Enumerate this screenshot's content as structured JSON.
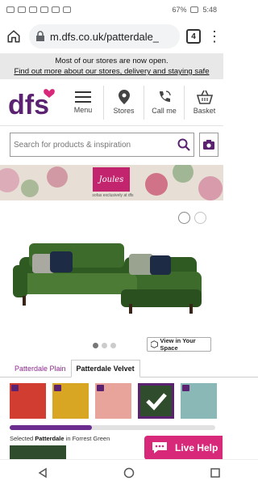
{
  "status_bar": {
    "left_icons": [
      "nfc-icon",
      "signal-icon",
      "wifi-icon",
      "battery-saver-icon",
      "alarm-icon",
      "bluetooth-icon",
      "vibrate-icon",
      "no-sound-icon"
    ],
    "battery": "67%",
    "time": "5:48"
  },
  "browser": {
    "url": "m.dfs.co.uk/patterdale_",
    "tab_count": "4"
  },
  "notice": {
    "line1": "Most of our stores are now open.",
    "link": "Find out more about our stores, delivery and staying safe"
  },
  "header": {
    "logo_text": "dfs",
    "nav": [
      {
        "label": "Menu",
        "icon": "hamburger-menu-icon"
      },
      {
        "label": "Stores",
        "icon": "location-pin-icon"
      },
      {
        "label": "Call me",
        "icon": "phone-call-icon"
      },
      {
        "label": "Basket",
        "icon": "basket-icon"
      }
    ]
  },
  "search": {
    "placeholder": "Search for products & inspiration"
  },
  "banner": {
    "brand": "Joules",
    "sub": "sofas exclusively at dfs"
  },
  "product": {
    "image_dots_count": 3,
    "active_dot": 0,
    "view_in_space": "View in Your Space"
  },
  "fabric_tabs": [
    {
      "label": "Patterdale Plain",
      "active": false
    },
    {
      "label": "Patterdale Velvet",
      "active": true
    }
  ],
  "swatches": [
    {
      "color": "#d23d32",
      "selected": false
    },
    {
      "color": "#d9a624",
      "selected": false
    },
    {
      "color": "#e8a39b",
      "selected": false
    },
    {
      "color": "#2f4d2c",
      "selected": true
    },
    {
      "color": "#8ab8b6",
      "selected": false
    }
  ],
  "scroll_progress_percent": 40,
  "selected_text_prefix": "Selected",
  "selected_text_value": "Patterdale",
  "selected_text_suffix": "in Forrest Green",
  "live_help": "Live Help",
  "colors": {
    "brand_purple": "#5a2270",
    "live_help_pink": "#d7287a",
    "sofa_green": "#3d6b2b"
  }
}
